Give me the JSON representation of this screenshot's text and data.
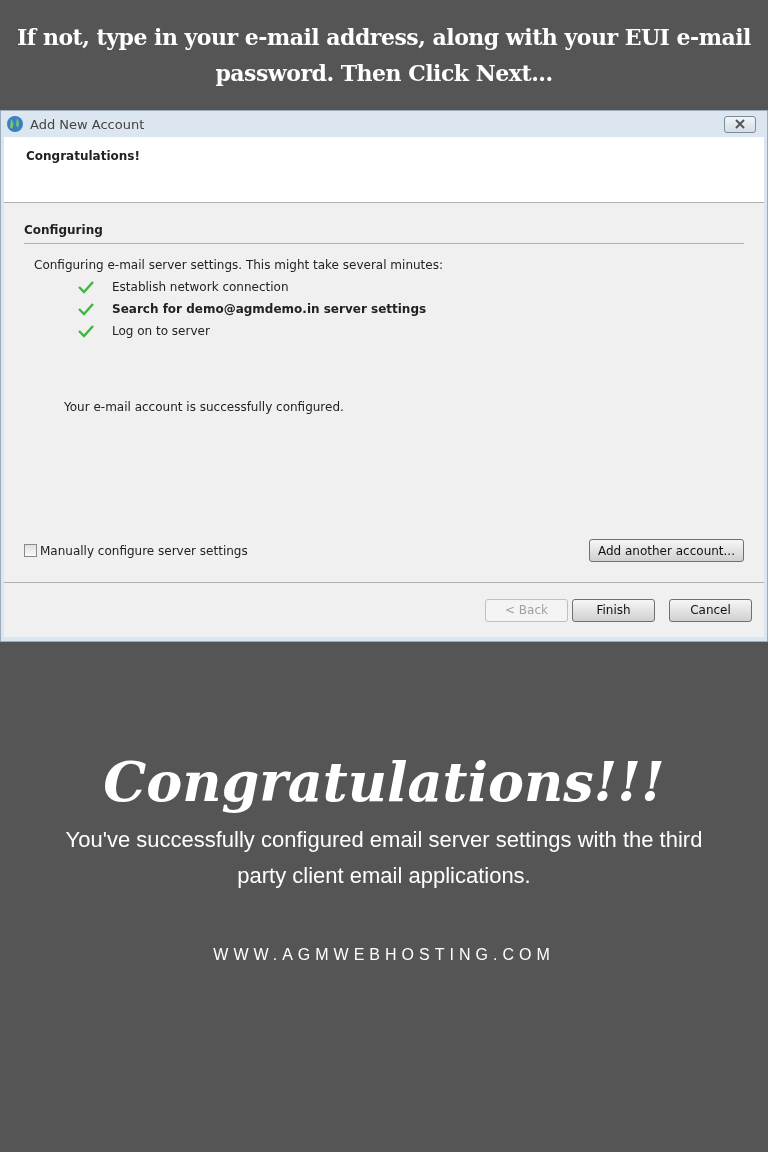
{
  "banner": {
    "text": "If not, type in your e-mail address, along with your EUI e-mail password. Then Click Next..."
  },
  "dialog": {
    "title": "Add New Account",
    "header": "Congratulations!",
    "section": "Configuring",
    "intro": "Configuring e-mail server settings. This might take several minutes:",
    "steps": [
      {
        "label": "Establish network connection",
        "done": true,
        "bold": false
      },
      {
        "label": "Search for demo@agmdemo.in server settings",
        "done": true,
        "bold": true
      },
      {
        "label": "Log on to server",
        "done": true,
        "bold": false
      }
    ],
    "result": "Your e-mail account is successfully configured.",
    "manual": {
      "label": "Manually configure server settings",
      "checked": false
    },
    "add_button": {
      "label": "Add another account...",
      "disabled": false
    },
    "buttons": [
      {
        "label": "< Back",
        "disabled": true
      },
      {
        "label": "Finish",
        "disabled": false
      },
      {
        "label": "Cancel",
        "disabled": false
      }
    ]
  },
  "footer": {
    "headline": "Congratulations!!!",
    "message": "You've successfully configured email server settings with the third party client email applications.",
    "website": "WWW.AGMWEBHOSTING.COM"
  }
}
